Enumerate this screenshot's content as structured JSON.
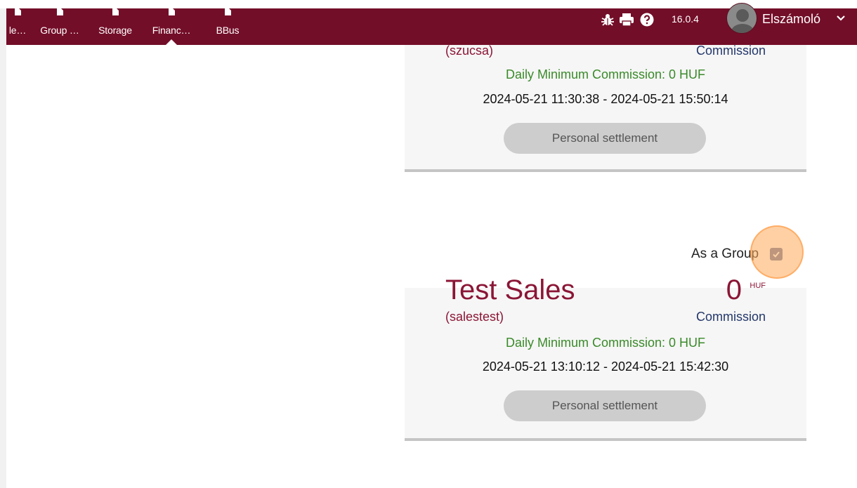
{
  "nav": {
    "items": [
      {
        "label": "le…",
        "active": false
      },
      {
        "label": "Group …",
        "active": false
      },
      {
        "label": "Storage",
        "active": false
      },
      {
        "label": "Financ…",
        "active": true
      },
      {
        "label": "BBus",
        "active": false
      }
    ],
    "tools": [
      "bug-icon",
      "printer-icon",
      "help-icon"
    ],
    "version": "16.0.4",
    "user": "Elszámoló",
    "colors": {
      "bar": "#730e28",
      "accent": "#8b1535",
      "commission": "#23376b",
      "green": "#3a8a2a"
    }
  },
  "cards": [
    {
      "username": "(szucsa)",
      "commission_label": "Commission",
      "daily_min": "Daily Minimum Commission: 0 HUF",
      "start": "2024-05-21 11:30:38",
      "sep": "-",
      "end": "2024-05-21 15:50:14",
      "button": "Personal settlement"
    },
    {
      "name": "Test Sales",
      "amount": "0",
      "currency": "HUF",
      "username": "(salestest)",
      "commission_label": "Commission",
      "daily_min": "Daily Minimum Commission: 0 HUF",
      "start": "2024-05-21 13:10:12",
      "sep": "-",
      "end": "2024-05-21 15:42:30",
      "button": "Personal settlement"
    }
  ],
  "group": {
    "label": "As a Group",
    "checked": true
  }
}
